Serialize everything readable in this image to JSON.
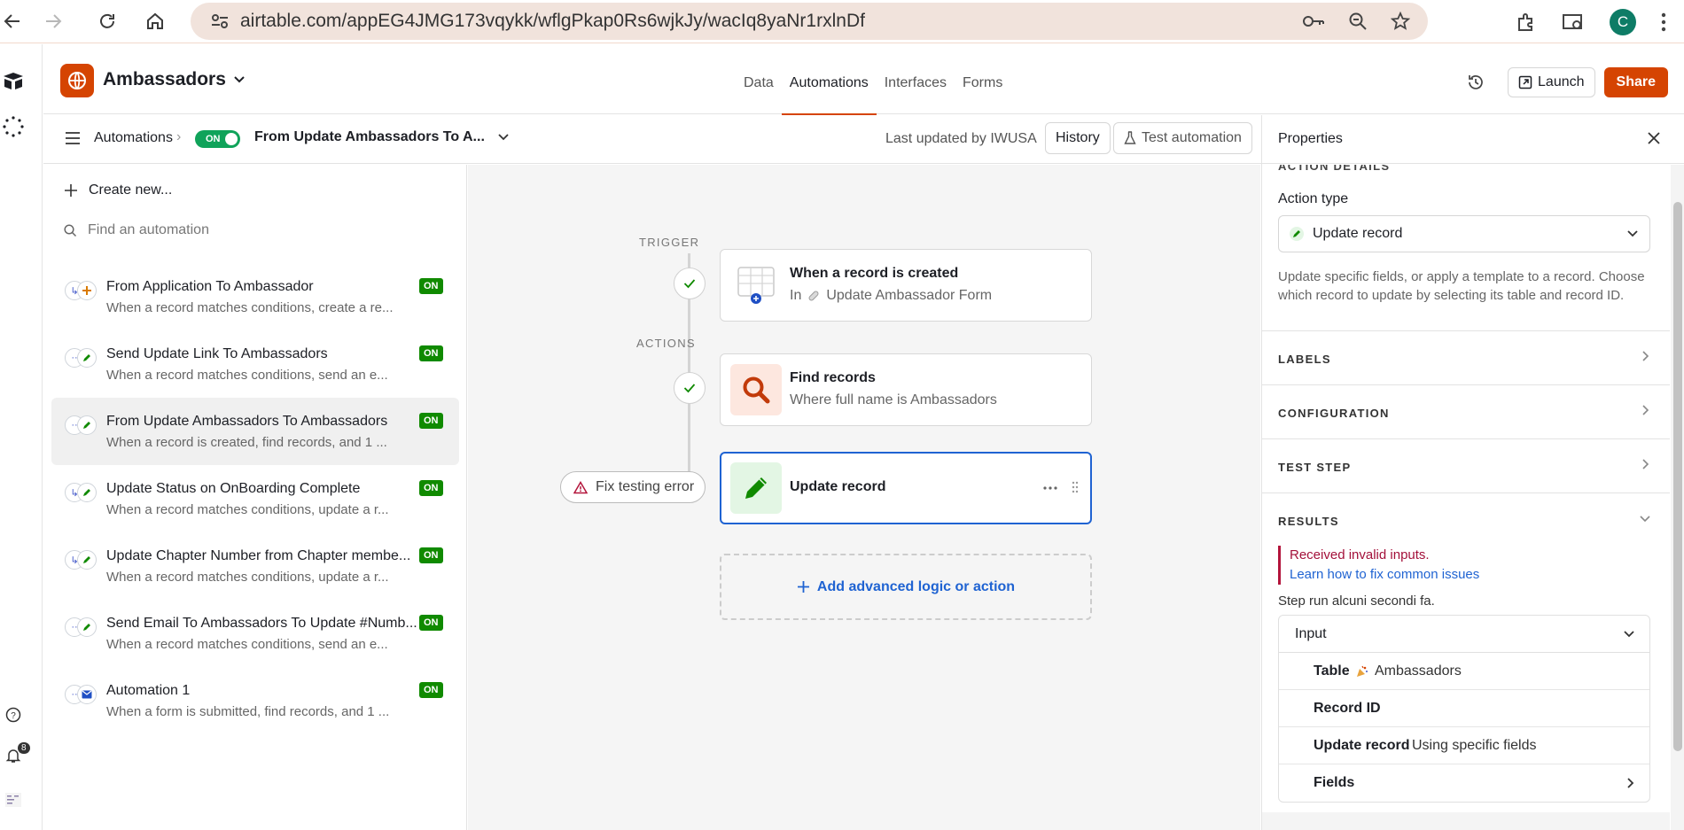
{
  "browser": {
    "url": "airtable.com/appEG4JMG173vqykk/wflgPkap0Rs6wjkJy/wacIq8yaNr1rxlnDf",
    "profile_initial": "C"
  },
  "rail": {
    "notification_count": "8"
  },
  "app": {
    "name": "Ambassadors",
    "tabs": [
      "Data",
      "Automations",
      "Interfaces",
      "Forms"
    ],
    "active_tab": "Automations",
    "launch_label": "Launch",
    "share_label": "Share",
    "brand_color": "#d54402"
  },
  "subheader": {
    "breadcrumb": "Automations",
    "toggle_label": "ON",
    "automation_name": "From Update Ambassadors To A...",
    "last_updated": "Last updated by IWUSA",
    "history_label": "History",
    "test_label": "Test automation"
  },
  "sidebar": {
    "create_label": "Create new...",
    "search_placeholder": "Find an automation",
    "items": [
      {
        "title": "From Application To Ambassador",
        "desc": "When a record matches conditions, create a re...",
        "badge": "ON",
        "icon": "plus-icon",
        "selected": false
      },
      {
        "title": "Send Update Link To Ambassadors",
        "desc": "When a record matches conditions, send an e...",
        "badge": "ON",
        "icon": "pencil-icon",
        "selected": false
      },
      {
        "title": "From Update Ambassadors To Ambassadors",
        "desc": "When a record is created, find records, and 1 ...",
        "badge": "ON",
        "icon": "pencil-icon",
        "selected": true
      },
      {
        "title": "Update Status on OnBoarding Complete",
        "desc": "When a record matches conditions, update a r...",
        "badge": "ON",
        "icon": "pencil-icon",
        "selected": false
      },
      {
        "title": "Update Chapter Number from Chapter membe...",
        "desc": "When a record matches conditions, update a r...",
        "badge": "ON",
        "icon": "pencil-icon",
        "selected": false
      },
      {
        "title": "Send Email To Ambassadors To Update #Numb...",
        "desc": "When a record matches conditions, send an e...",
        "badge": "ON",
        "icon": "pencil-icon",
        "selected": false
      },
      {
        "title": "Automation 1",
        "desc": "When a form is submitted, find records, and 1 ...",
        "badge": "ON",
        "icon": "mail-icon",
        "selected": false
      }
    ]
  },
  "canvas": {
    "trigger_label": "TRIGGER",
    "actions_label": "ACTIONS",
    "trigger_card": {
      "title": "When a record is created",
      "sub_prefix": "In",
      "sub": "Update Ambassador Form"
    },
    "find_card": {
      "title": "Find records",
      "sub": "Where full name is Ambassadors"
    },
    "update_card": {
      "title": "Update record"
    },
    "fix_label": "Fix testing error",
    "add_label": "Add advanced logic or action"
  },
  "properties": {
    "title": "Properties",
    "action_details_label": "ACTION DETAILS",
    "action_type_label": "Action type",
    "action_type_value": "Update record",
    "description": "Update specific fields, or apply a template to a record. Choose which record to update by selecting its table and record ID.",
    "sections": [
      "LABELS",
      "CONFIGURATION",
      "TEST STEP",
      "RESULTS"
    ],
    "error_text": "Received invalid inputs.",
    "help_link": "Learn how to fix common issues",
    "step_run": "Step run alcuni secondi fa.",
    "input_label": "Input",
    "input_rows": [
      {
        "key": "Table",
        "value": "Ambassadors"
      },
      {
        "key": "Record ID",
        "value": ""
      },
      {
        "key": "Update record",
        "value": "Using specific fields"
      },
      {
        "key": "Fields",
        "value": ""
      }
    ]
  }
}
